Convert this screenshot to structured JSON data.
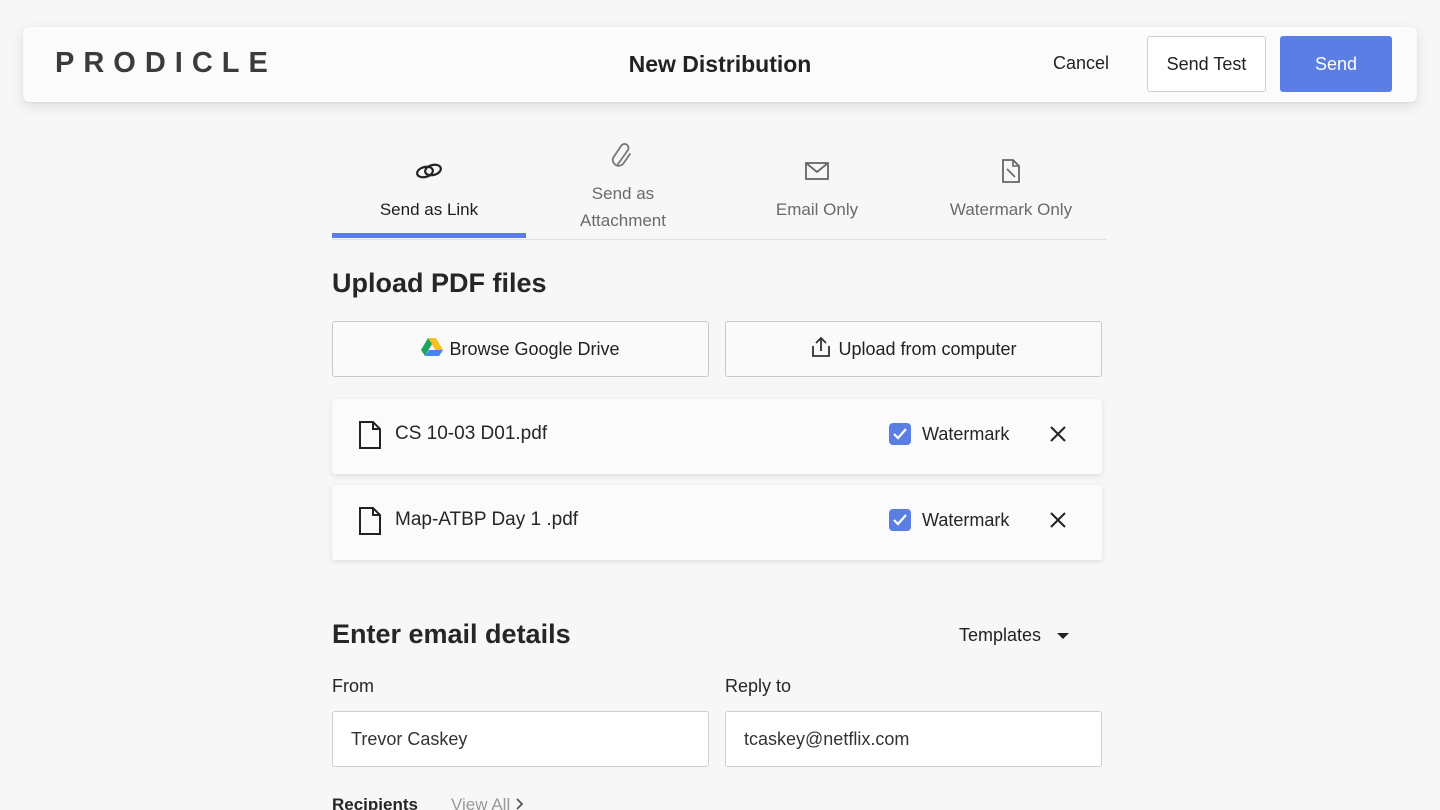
{
  "header": {
    "logo": "PRODICLE",
    "title": "New Distribution",
    "cancel_label": "Cancel",
    "send_test_label": "Send Test",
    "send_label": "Send"
  },
  "tabs": [
    {
      "label": "Send as Link",
      "icon": "link-icon",
      "active": true
    },
    {
      "label": "Send as\nAttachment",
      "label_line1": "Send as",
      "label_line2": "Attachment",
      "icon": "paperclip-icon",
      "active": false
    },
    {
      "label": "Email Only",
      "icon": "envelope-icon",
      "active": false
    },
    {
      "label": "Watermark Only",
      "icon": "watermark-file-icon",
      "active": false
    }
  ],
  "upload": {
    "heading": "Upload PDF files",
    "google_drive_label": "Browse Google Drive",
    "computer_label": "Upload from computer"
  },
  "files": [
    {
      "name": "CS 10-03 D01.pdf",
      "watermark_label": "Watermark",
      "watermark_checked": true
    },
    {
      "name": "Map-ATBP Day 1 .pdf",
      "watermark_label": "Watermark",
      "watermark_checked": true
    }
  ],
  "email": {
    "heading": "Enter email details",
    "templates_label": "Templates",
    "from_label": "From",
    "from_value": "Trevor Caskey",
    "reply_to_label": "Reply to",
    "reply_to_value": "tcaskey@netflix.com",
    "recipients_label": "Recipients",
    "view_all_label": "View All"
  },
  "colors": {
    "accent": "#5b7ee5",
    "background": "#f7f7f7"
  }
}
